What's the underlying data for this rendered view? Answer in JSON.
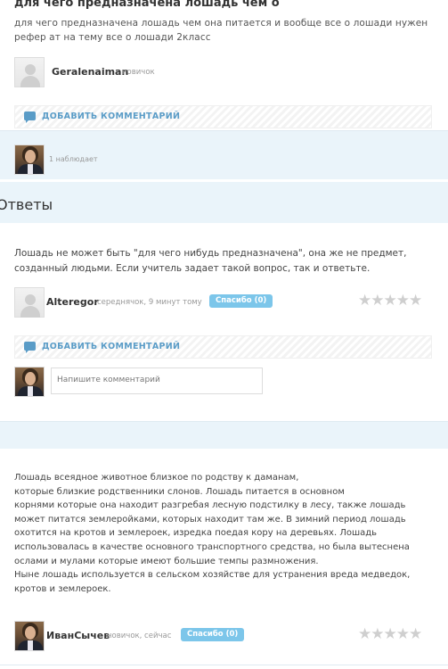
{
  "question": {
    "title": "для чего предназначена лошадь чем о",
    "text": "для чего предназначена лошадь чем она питается и вообще все о лошади нужен рефер ат на тему все о лошади 2класс",
    "author": {
      "name": "Geralenaiman",
      "rank": "новичок"
    },
    "add_comment": "ДОБАВИТЬ КОММЕНТАРИЙ",
    "watchers": "1 наблюдает"
  },
  "answers_heading": "Ответы",
  "answers": [
    {
      "text": "Лошадь не может быть \"для чего нибудь предназначена\", она же не предмет, созданный людьми. Если учитель задает такой вопрос, так и ответьте.",
      "author": "Alteregor",
      "meta": "середнячок, 9 минут тому",
      "thanks": "Спасибо (0)",
      "stars": "★★★★★",
      "add_comment": "ДОБАВИТЬ КОММЕНТАРИЙ",
      "comment_placeholder": "Напишите комментарий"
    },
    {
      "lines": [
        "Лошадь всеядное животное близкое по родству к даманам,",
        "которые близкие родственники слонов. Лошадь питается  в основном",
        "корнями которые она находит разгребая лесную подстилку в лесу, также лошадь",
        "может питатся землеройками, которых находит там же. В зимний период лошадь",
        "охотится на кротов и землероек, изредка поедая кору на деревьях. Лошадь",
        "использовалась в качестве основного транспортного средства, но была вытеснена",
        "ослами и мулами которые имеют большие темпы размножения.",
        "Ныне лошадь используется в сельском хозяйстве для устранения вреда медведок,",
        "кротов и землероек."
      ],
      "author": "ИванСычев",
      "meta": "новичок, сейчас",
      "thanks": "Спасибо (0)",
      "stars": "★★★★★"
    }
  ]
}
